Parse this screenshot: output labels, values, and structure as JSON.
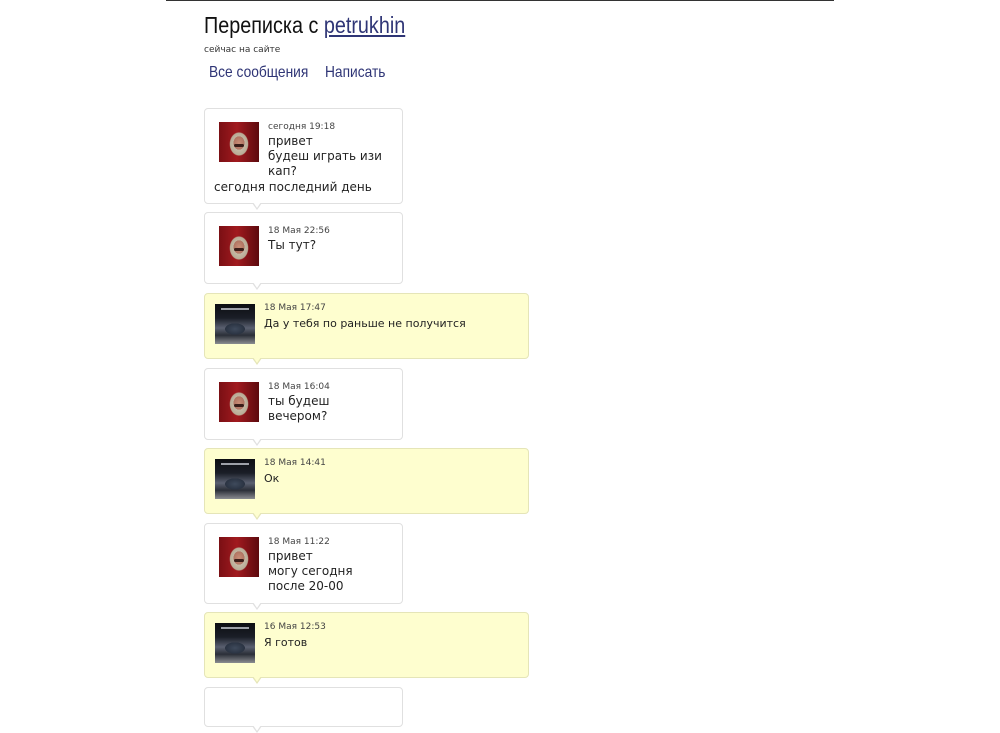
{
  "header": {
    "title_prefix": "Переписка с",
    "username": "petrukhin",
    "status": "сейчас на сайте"
  },
  "nav": {
    "all_messages": "Все сообщения",
    "write": "Написать"
  },
  "messages": [
    {
      "from": "friend",
      "time": "сегодня 19:18",
      "text": "привет\nбудеш играть изи\nкап?",
      "extra": "сегодня последний день"
    },
    {
      "from": "friend",
      "time": "18 Мая 22:56",
      "text": "Ты тут?"
    },
    {
      "from": "me",
      "time": "18 Мая 17:47",
      "text": "Да у тебя по раньше не получится"
    },
    {
      "from": "friend",
      "time": "18 Мая 16:04",
      "text": "ты будеш\nвечером?"
    },
    {
      "from": "me",
      "time": "18 Мая 14:41",
      "text": "Ок"
    },
    {
      "from": "friend",
      "time": "18 Мая 11:22",
      "text": "привет\nмогу сегодня\nпосле 20-00"
    },
    {
      "from": "me",
      "time": "16 Мая 12:53",
      "text": "Я готов"
    }
  ]
}
